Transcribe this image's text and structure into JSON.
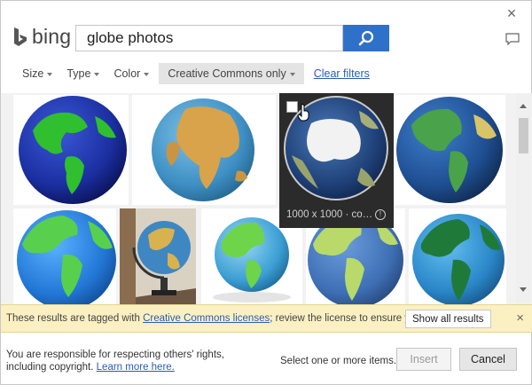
{
  "dialog": {
    "brand": "bing",
    "close_label": "×"
  },
  "search": {
    "query": "globe photos",
    "button_icon": "search-icon"
  },
  "filters": [
    {
      "label": "Size"
    },
    {
      "label": "Type"
    },
    {
      "label": "Color"
    },
    {
      "label": "Creative Commons only",
      "active": true
    }
  ],
  "clear_filters": "Clear filters",
  "results": {
    "hovered": {
      "caption": "1000 x 1000 · co…",
      "info_icon": "info-icon"
    }
  },
  "notice": {
    "prefix": "These results are tagged with ",
    "link": "Creative Commons licenses",
    "suffix": "; review the license to ensure you comply.",
    "button": "Show all results"
  },
  "footer": {
    "responsible_text": "You are responsible for respecting others' rights, including copyright.",
    "learn_more": "Learn more here.",
    "status": "Select one or more items.",
    "insert": "Insert",
    "cancel": "Cancel"
  },
  "colors": {
    "accent": "#2f71c9",
    "notice_bg": "#fbf0c2",
    "link": "#2a5db0"
  }
}
